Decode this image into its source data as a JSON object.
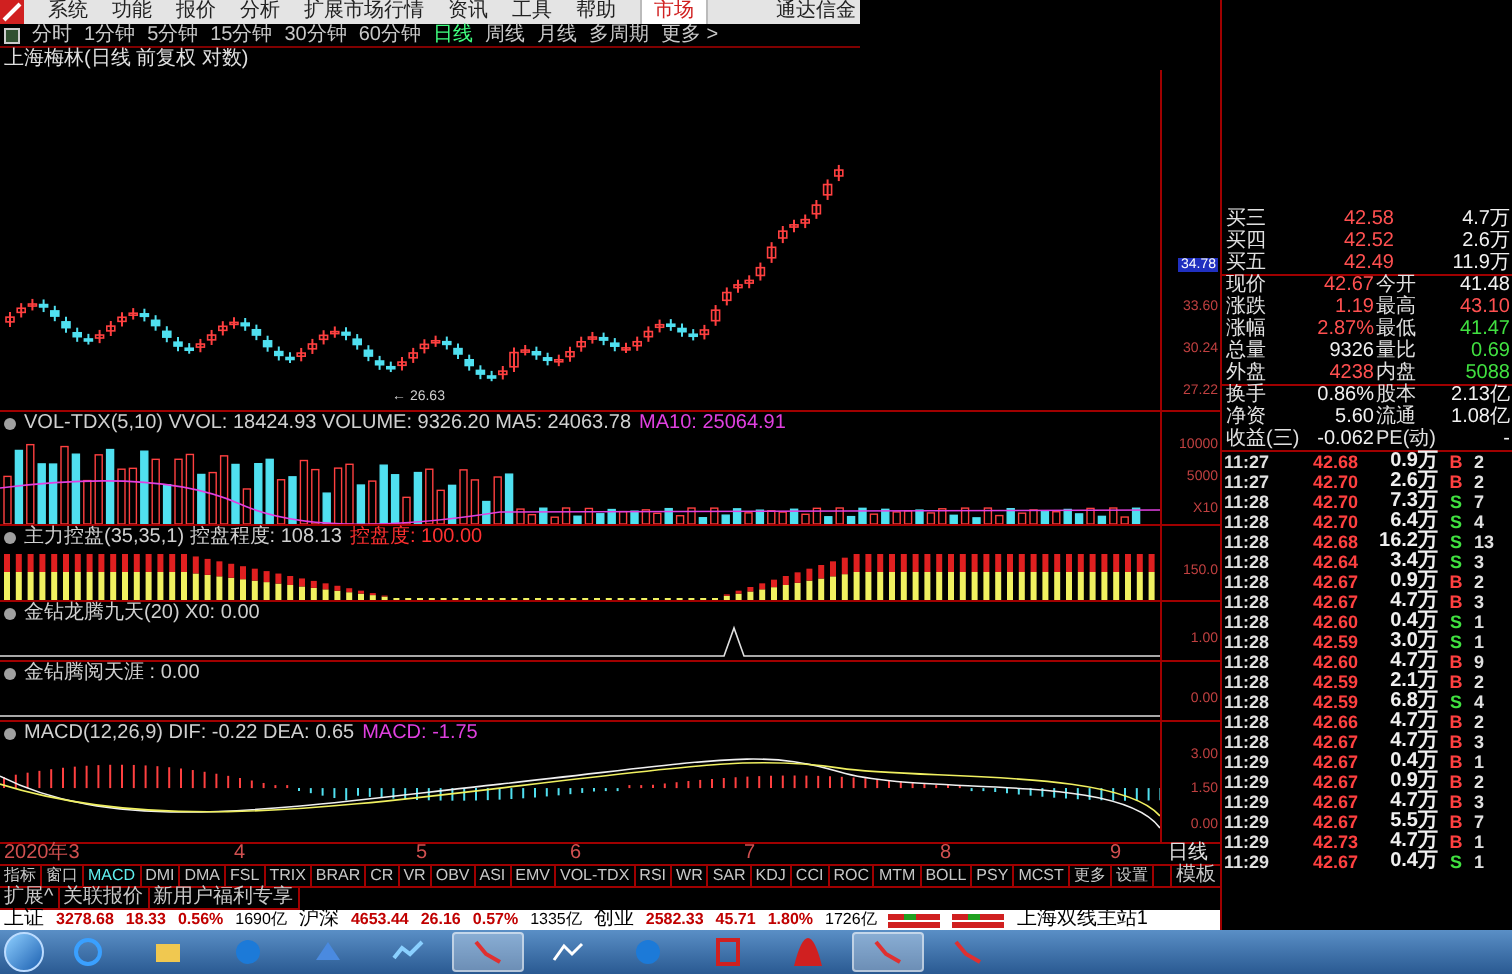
{
  "menu_bar": {
    "items": [
      "系统",
      "功能",
      "报价",
      "分析",
      "扩展市场行情",
      "资讯",
      "工具",
      "帮助"
    ],
    "market_tab": "市场",
    "app_title": "通达信金"
  },
  "period_bar": {
    "items": [
      {
        "label": "分时",
        "selected": false
      },
      {
        "label": "1分钟",
        "selected": false
      },
      {
        "label": "5分钟",
        "selected": false
      },
      {
        "label": "15分钟",
        "selected": false
      },
      {
        "label": "30分钟",
        "selected": false
      },
      {
        "label": "60分钟",
        "selected": false
      },
      {
        "label": "日线",
        "selected": true
      },
      {
        "label": "周线",
        "selected": false
      },
      {
        "label": "月线",
        "selected": false
      },
      {
        "label": "多周期",
        "selected": false
      },
      {
        "label": "更多 >",
        "selected": false
      }
    ]
  },
  "chart_title": "上海梅林(日线 前复权 对数)",
  "price_pane": {
    "low_label": "← 26.63",
    "axis_labels": [
      {
        "text": "34.78",
        "highlighted": true
      },
      {
        "text": "33.60",
        "highlighted": false
      },
      {
        "text": "30.24",
        "highlighted": false
      },
      {
        "text": "27.22",
        "highlighted": false
      }
    ]
  },
  "indicator_panes": [
    {
      "kind": "volume",
      "legend": [
        {
          "text": "VOL-TDX(5,10) VVOL: 18424.93  VOLUME: 9326.20  MA5: 24063.78",
          "color": "#d0d0d0"
        },
        {
          "text": "MA10: 25064.91",
          "color": "#e040e0"
        }
      ],
      "axis_labels": [
        "10000",
        "5000",
        "X10"
      ]
    },
    {
      "kind": "control",
      "legend": [
        {
          "text": "主力控盘(35,35,1) 控盘程度: 108.13",
          "color": "#d0d0d0"
        },
        {
          "text": "控盘度: 100.00",
          "color": "#ff3030"
        }
      ],
      "axis_labels": [
        "150.0"
      ]
    },
    {
      "kind": "spike",
      "legend": [
        {
          "text": "金钻龙腾九天(20) X0: 0.00",
          "color": "#d0d0d0"
        }
      ],
      "axis_labels": [
        "1.00"
      ]
    },
    {
      "kind": "flat",
      "legend": [
        {
          "text": "金钻腾阅天涯 : 0.00",
          "color": "#d0d0d0"
        }
      ],
      "axis_labels": [
        "0.00"
      ]
    },
    {
      "kind": "macd",
      "legend": [
        {
          "text": "MACD(12,26,9) DIF: -0.22  DEA: 0.65",
          "color": "#d0d0d0"
        },
        {
          "text": "MACD: -1.75",
          "color": "#e040e0"
        }
      ],
      "axis_labels": [
        "3.00",
        "1.50",
        "0.00"
      ]
    }
  ],
  "date_axis": {
    "labels": [
      "2020年3",
      "4",
      "5",
      "6",
      "7",
      "8",
      "9"
    ],
    "period": "日线"
  },
  "indicator_tabs": [
    {
      "label": "指标",
      "selected": false
    },
    {
      "label": "窗口",
      "selected": false
    },
    {
      "label": "MACD",
      "selected": true
    },
    {
      "label": "DMI",
      "selected": false
    },
    {
      "label": "DMA",
      "selected": false
    },
    {
      "label": "FSL",
      "selected": false
    },
    {
      "label": "TRIX",
      "selected": false
    },
    {
      "label": "BRAR",
      "selected": false
    },
    {
      "label": "CR",
      "selected": false
    },
    {
      "label": "VR",
      "selected": false
    },
    {
      "label": "OBV",
      "selected": false
    },
    {
      "label": "ASI",
      "selected": false
    },
    {
      "label": "EMV",
      "selected": false
    },
    {
      "label": "VOL-TDX",
      "selected": false
    },
    {
      "label": "RSI",
      "selected": false
    },
    {
      "label": "WR",
      "selected": false
    },
    {
      "label": "SAR",
      "selected": false
    },
    {
      "label": "KDJ",
      "selected": false
    },
    {
      "label": "CCI",
      "selected": false
    },
    {
      "label": "ROC",
      "selected": false
    },
    {
      "label": "MTM",
      "selected": false
    },
    {
      "label": "BOLL",
      "selected": false
    },
    {
      "label": "PSY",
      "selected": false
    },
    {
      "label": "MCST",
      "selected": false
    },
    {
      "label": "更多",
      "selected": false
    },
    {
      "label": "设置",
      "selected": false
    }
  ],
  "template_button": "模板",
  "extension_tabs": [
    "扩展^",
    "关联报价",
    "新用户福利专享"
  ],
  "status_bar": {
    "indices": [
      {
        "name": "上证",
        "value": "3278.68",
        "change": "18.33",
        "percent": "0.56%",
        "amount": "1690亿"
      },
      {
        "name": "沪深",
        "value": "4653.44",
        "change": "26.16",
        "percent": "0.57%",
        "amount": "1335亿"
      },
      {
        "name": "创业",
        "value": "2582.33",
        "change": "45.71",
        "percent": "1.80%",
        "amount": "1726亿"
      }
    ],
    "server": "上海双线主站1"
  },
  "quote": {
    "bids": [
      {
        "label": "买三",
        "price": "42.58",
        "volume": "4.7万"
      },
      {
        "label": "买四",
        "price": "42.52",
        "volume": "2.6万"
      },
      {
        "label": "买五",
        "price": "42.49",
        "volume": "11.9万"
      }
    ],
    "stats": [
      [
        {
          "label": "现价",
          "value": "42.67",
          "color": "#ff5050"
        },
        {
          "label": "今开",
          "value": "41.48",
          "color": "#f0f0f0"
        }
      ],
      [
        {
          "label": "涨跌",
          "value": "1.19",
          "color": "#ff5050"
        },
        {
          "label": "最高",
          "value": "43.10",
          "color": "#ff5050"
        }
      ],
      [
        {
          "label": "涨幅",
          "value": "2.87%",
          "color": "#ff5050"
        },
        {
          "label": "最低",
          "value": "41.47",
          "color": "#40e040"
        }
      ],
      [
        {
          "label": "总量",
          "value": "9326",
          "color": "#f0f0f0"
        },
        {
          "label": "量比",
          "value": "0.69",
          "color": "#40e040"
        }
      ],
      [
        {
          "label": "外盘",
          "value": "4238",
          "color": "#ff5050"
        },
        {
          "label": "内盘",
          "value": "5088",
          "color": "#40e040"
        }
      ],
      [
        {
          "label": "换手",
          "value": "0.86%",
          "color": "#f0f0f0"
        },
        {
          "label": "股本",
          "value": "2.13亿",
          "color": "#f0f0f0"
        }
      ],
      [
        {
          "label": "净资",
          "value": "5.60",
          "color": "#f0f0f0"
        },
        {
          "label": "流通",
          "value": "1.08亿",
          "color": "#f0f0f0"
        }
      ],
      [
        {
          "label": "收益(三)",
          "value": "-0.062",
          "color": "#f0f0f0"
        },
        {
          "label": "PE(动)",
          "value": "-",
          "color": "#f0f0f0"
        }
      ]
    ]
  },
  "trades": [
    {
      "time": "11:27",
      "price": "42.68",
      "volume": "0.9万",
      "side": "B",
      "kind": "buy",
      "count": "2"
    },
    {
      "time": "11:27",
      "price": "42.70",
      "volume": "2.6万",
      "side": "B",
      "kind": "buy",
      "count": "2"
    },
    {
      "time": "11:28",
      "price": "42.70",
      "volume": "7.3万",
      "side": "S",
      "kind": "sell",
      "count": "7"
    },
    {
      "time": "11:28",
      "price": "42.70",
      "volume": "6.4万",
      "side": "S",
      "kind": "sell",
      "count": "4"
    },
    {
      "time": "11:28",
      "price": "42.68",
      "volume": "16.2万",
      "side": "S",
      "kind": "sell",
      "count": "13"
    },
    {
      "time": "11:28",
      "price": "42.64",
      "volume": "3.4万",
      "side": "S",
      "kind": "sell",
      "count": "3"
    },
    {
      "time": "11:28",
      "price": "42.67",
      "volume": "0.9万",
      "side": "B",
      "kind": "buy",
      "count": "2"
    },
    {
      "time": "11:28",
      "price": "42.67",
      "volume": "4.7万",
      "side": "B",
      "kind": "buy",
      "count": "3"
    },
    {
      "time": "11:28",
      "price": "42.60",
      "volume": "0.4万",
      "side": "S",
      "kind": "sell",
      "count": "1"
    },
    {
      "time": "11:28",
      "price": "42.59",
      "volume": "3.0万",
      "side": "S",
      "kind": "sell",
      "count": "1"
    },
    {
      "time": "11:28",
      "price": "42.60",
      "volume": "4.7万",
      "side": "B",
      "kind": "buy",
      "count": "9"
    },
    {
      "time": "11:28",
      "price": "42.59",
      "volume": "2.1万",
      "side": "B",
      "kind": "buy",
      "count": "2"
    },
    {
      "time": "11:28",
      "price": "42.59",
      "volume": "6.8万",
      "side": "S",
      "kind": "sell",
      "count": "4"
    },
    {
      "time": "11:28",
      "price": "42.66",
      "volume": "4.7万",
      "side": "B",
      "kind": "buy",
      "count": "2"
    },
    {
      "time": "11:28",
      "price": "42.67",
      "volume": "4.7万",
      "side": "B",
      "kind": "buy",
      "count": "3"
    },
    {
      "time": "11:29",
      "price": "42.67",
      "volume": "0.4万",
      "side": "B",
      "kind": "buy",
      "count": "1"
    },
    {
      "time": "11:29",
      "price": "42.67",
      "volume": "0.9万",
      "side": "B",
      "kind": "buy",
      "count": "2"
    },
    {
      "time": "11:29",
      "price": "42.67",
      "volume": "4.7万",
      "side": "B",
      "kind": "buy",
      "count": "3"
    },
    {
      "time": "11:29",
      "price": "42.67",
      "volume": "5.5万",
      "side": "B",
      "kind": "buy",
      "count": "7"
    },
    {
      "time": "11:29",
      "price": "42.73",
      "volume": "4.7万",
      "side": "B",
      "kind": "buy",
      "count": "1"
    },
    {
      "time": "11:29",
      "price": "42.67",
      "volume": "0.4万",
      "side": "S",
      "kind": "sell",
      "count": "1"
    }
  ],
  "taskbar": {
    "apps": [
      {
        "kind": "globe",
        "selected": false
      },
      {
        "kind": "folder",
        "selected": false
      },
      {
        "kind": "circle",
        "selected": false
      },
      {
        "kind": "bird",
        "selected": false
      },
      {
        "kind": "wave",
        "selected": false
      },
      {
        "kind": "chart",
        "selected": true
      },
      {
        "kind": "line",
        "selected": false
      },
      {
        "kind": "circle",
        "selected": false
      },
      {
        "kind": "seal",
        "selected": false
      },
      {
        "kind": "shell",
        "selected": false
      },
      {
        "kind": "chart",
        "selected": true
      },
      {
        "kind": "chart",
        "selected": false
      }
    ]
  }
}
